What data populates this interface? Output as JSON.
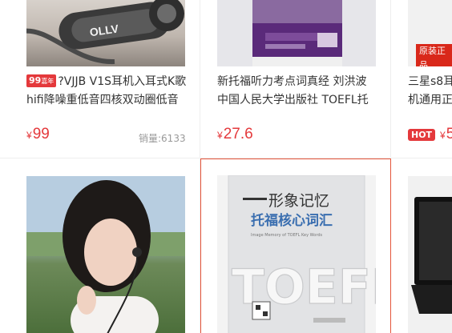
{
  "products": [
    {
      "badge_main": "99",
      "badge_small": "嘉年",
      "title_line1": "?VJJB V1S耳机入耳式K歌",
      "title_line2": "hifi降噪重低音四核双动圈低音",
      "price_symbol": "¥",
      "price": "99",
      "sales": "销量:6133",
      "image_brand": "OLLV"
    },
    {
      "title_line1": "新托福听力考点词真经 刘洪波",
      "title_line2": "中国人民大学出版社 TOEFL托",
      "price_symbol": "¥",
      "price": "27.6"
    },
    {
      "title_line1": "三星s8耳",
      "title_line2": "机通用正",
      "price_symbol": "¥",
      "price": "5",
      "hot_label": "HOT",
      "tag": "原装正品"
    },
    {},
    {
      "book_title_line1": "形象记忆",
      "book_title_line2": "托福核心词汇",
      "book_subtitle": "Image Memory of TOEFL Key Words",
      "book_word": "TOEFL"
    },
    {}
  ]
}
